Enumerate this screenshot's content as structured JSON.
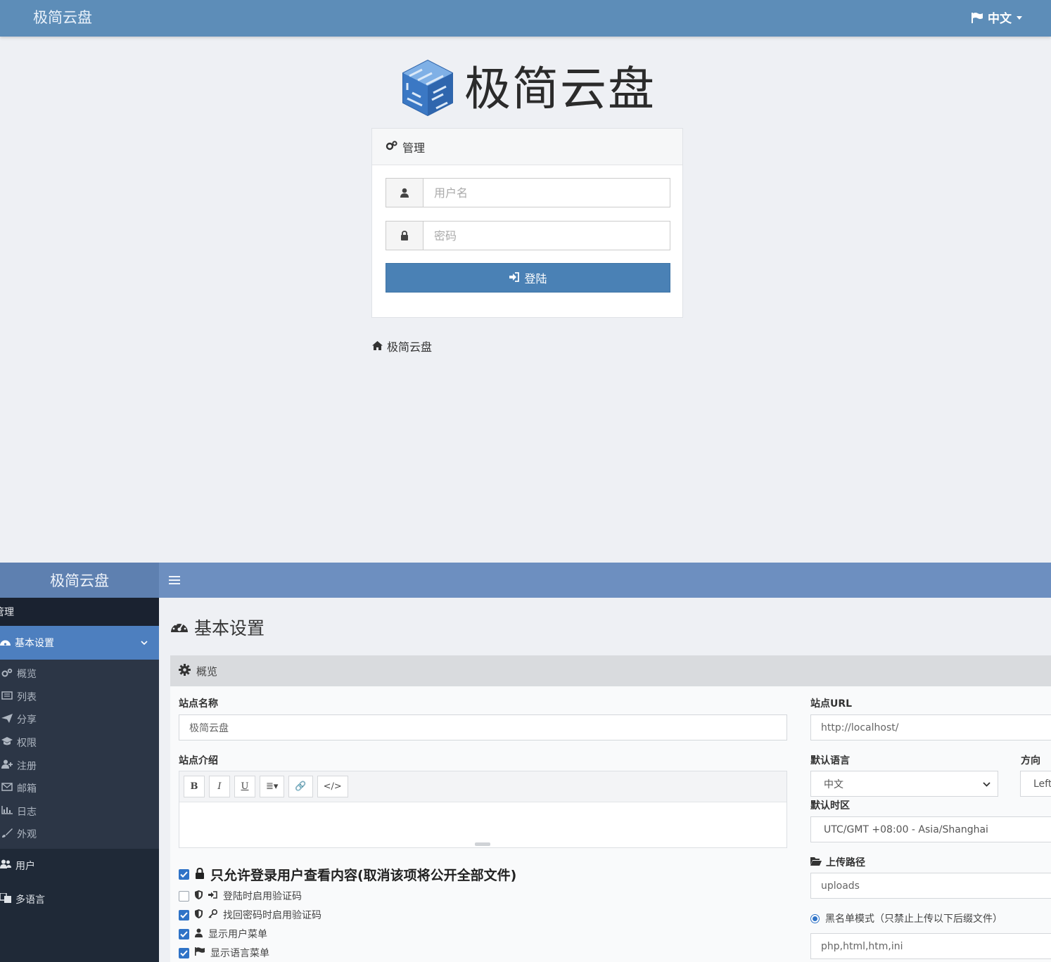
{
  "login": {
    "brand": "极简云盘",
    "language": "中文",
    "logo_text": "极简云盘",
    "card_title": "管理",
    "username_placeholder": "用户名",
    "password_placeholder": "密码",
    "login_button": "登陆",
    "home_link": "极简云盘"
  },
  "admin": {
    "brand": "极简云盘",
    "sidebar": {
      "section": "管理",
      "active": "基本设置",
      "sub_items": [
        {
          "label": "概览",
          "icon": "cogs-icon"
        },
        {
          "label": "列表",
          "icon": "list-icon"
        },
        {
          "label": "分享",
          "icon": "send-icon"
        },
        {
          "label": "权限",
          "icon": "graduation-cap-icon"
        },
        {
          "label": "注册",
          "icon": "user-plus-icon"
        },
        {
          "label": "邮箱",
          "icon": "envelope-icon"
        },
        {
          "label": "日志",
          "icon": "bar-chart-icon"
        },
        {
          "label": "外观",
          "icon": "brush-icon"
        }
      ],
      "items": [
        {
          "label": "用户",
          "icon": "users-icon"
        },
        {
          "label": "多语言",
          "icon": "language-icon"
        }
      ]
    },
    "page_title": "基本设置",
    "panel_title": "概览",
    "site_name_label": "站点名称",
    "site_name_value": "极简云盘",
    "site_intro_label": "站点介绍",
    "editor_buttons": [
      "B",
      "I",
      "U",
      "≣▾",
      "🔗",
      "</>"
    ],
    "site_url_label": "站点URL",
    "site_url_value": "http://localhost/",
    "default_lang_label": "默认语言",
    "default_lang_value": "中文",
    "direction_label": "方向",
    "direction_value": "Left",
    "timezone_label": "默认时区",
    "timezone_value": "UTC/GMT +08:00 - Asia/Shanghai",
    "upload_path_label": "上传路径",
    "upload_path_value": "uploads",
    "blacklist_label": "黑名单模式（只禁止上传以下后缀文件）",
    "blacklist_value": "php,html,htm,ini",
    "checks": [
      {
        "label": "只允许登录用户查看内容(取消该项将公开全部文件)",
        "checked": true
      },
      {
        "label": "登陆时启用验证码",
        "checked": false
      },
      {
        "label": "找回密码时启用验证码",
        "checked": true
      },
      {
        "label": "显示用户菜单",
        "checked": true
      },
      {
        "label": "显示语言菜单",
        "checked": true
      }
    ]
  },
  "colors": {
    "topbar": "#5d8db8",
    "login_button": "#4a81b5",
    "sidebar_bg": "#1f2937",
    "sidebar_active": "#4d7fbf",
    "checkbox": "#2f73c7"
  }
}
